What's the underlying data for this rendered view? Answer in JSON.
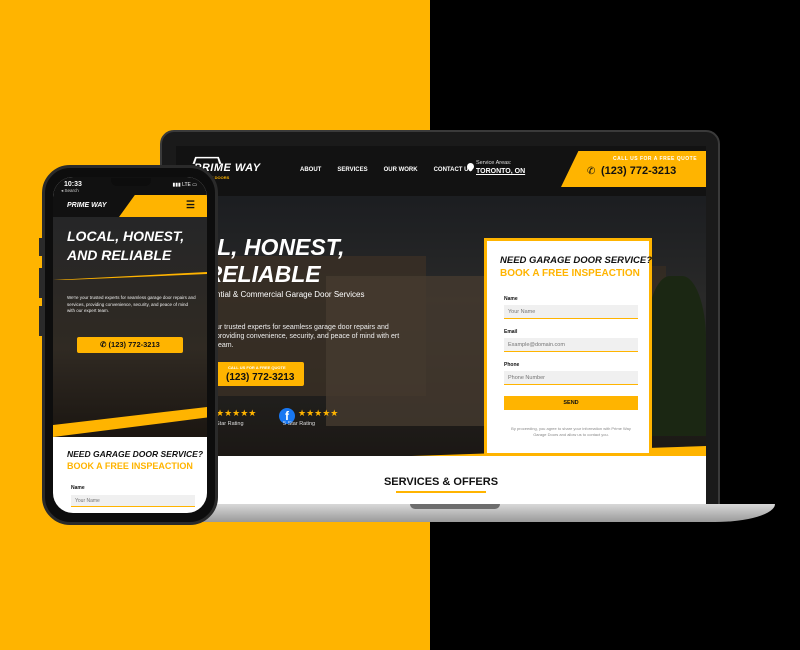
{
  "colors": {
    "accent": "#FFB400",
    "dark": "#121212",
    "facebook": "#1877F2"
  },
  "desktop": {
    "logo": {
      "name": "PRIME WAY",
      "sub": "GARAGE DOORS"
    },
    "nav": [
      "ABOUT",
      "SERVICES",
      "OUR WORK",
      "CONTACT US"
    ],
    "service_area": {
      "label": "Service Areas:",
      "city": "TORONTO, ON"
    },
    "call": {
      "label": "CALL US FOR A FREE QUOTE",
      "number": "(123) 772-3213"
    },
    "hero": {
      "title_line1": "OCAL, HONEST,",
      "title_line2": "ND RELIABLE",
      "subtitle": "ntial & Commercial Garage Door Services",
      "description": "ur trusted experts for seamless garage door repairs and providing convenience, security, and peace of mind with ert team.",
      "call_label": "CALL US FOR A FREE QUOTE",
      "call_number": "(123) 772-3213",
      "rating_a_stars": "★★★★★",
      "rating_a_label": "Star Rating",
      "rating_b_stars": "★★★★★",
      "rating_b_label": "5 Star Rating"
    },
    "form": {
      "title": "NEED GARAGE DOOR SERVICE?",
      "subtitle": "BOOK A FREE INSPEACTION",
      "name_label": "Name",
      "name_placeholder": "Your Name",
      "email_label": "Email",
      "email_placeholder": "Example@domain.com",
      "phone_label": "Phone",
      "phone_placeholder": "Phone Number",
      "send": "SEND",
      "disclaimer": "By proceeding, you agree to share your information with Prime Way Garage Doors and allow us to contact you."
    },
    "services_title": "SERVICES & OFFERS"
  },
  "mobile": {
    "time": "10:33",
    "back": "◂ Search",
    "signal": "▮▮▮ LTE ▭",
    "logo": "PRIME WAY",
    "hero_line1": "LOCAL, HONEST,",
    "hero_line2": "AND RELIABLE",
    "description": "We're your trusted experts for seamless garage door repairs and services, providing convenience, security, and peace of mind with our expert team.",
    "call_number": "(123) 772-3213",
    "form_title": "NEED GARAGE DOOR SERVICE?",
    "form_subtitle": "BOOK A FREE INSPEACTION",
    "name_label": "Name",
    "name_placeholder": "Your Name"
  }
}
